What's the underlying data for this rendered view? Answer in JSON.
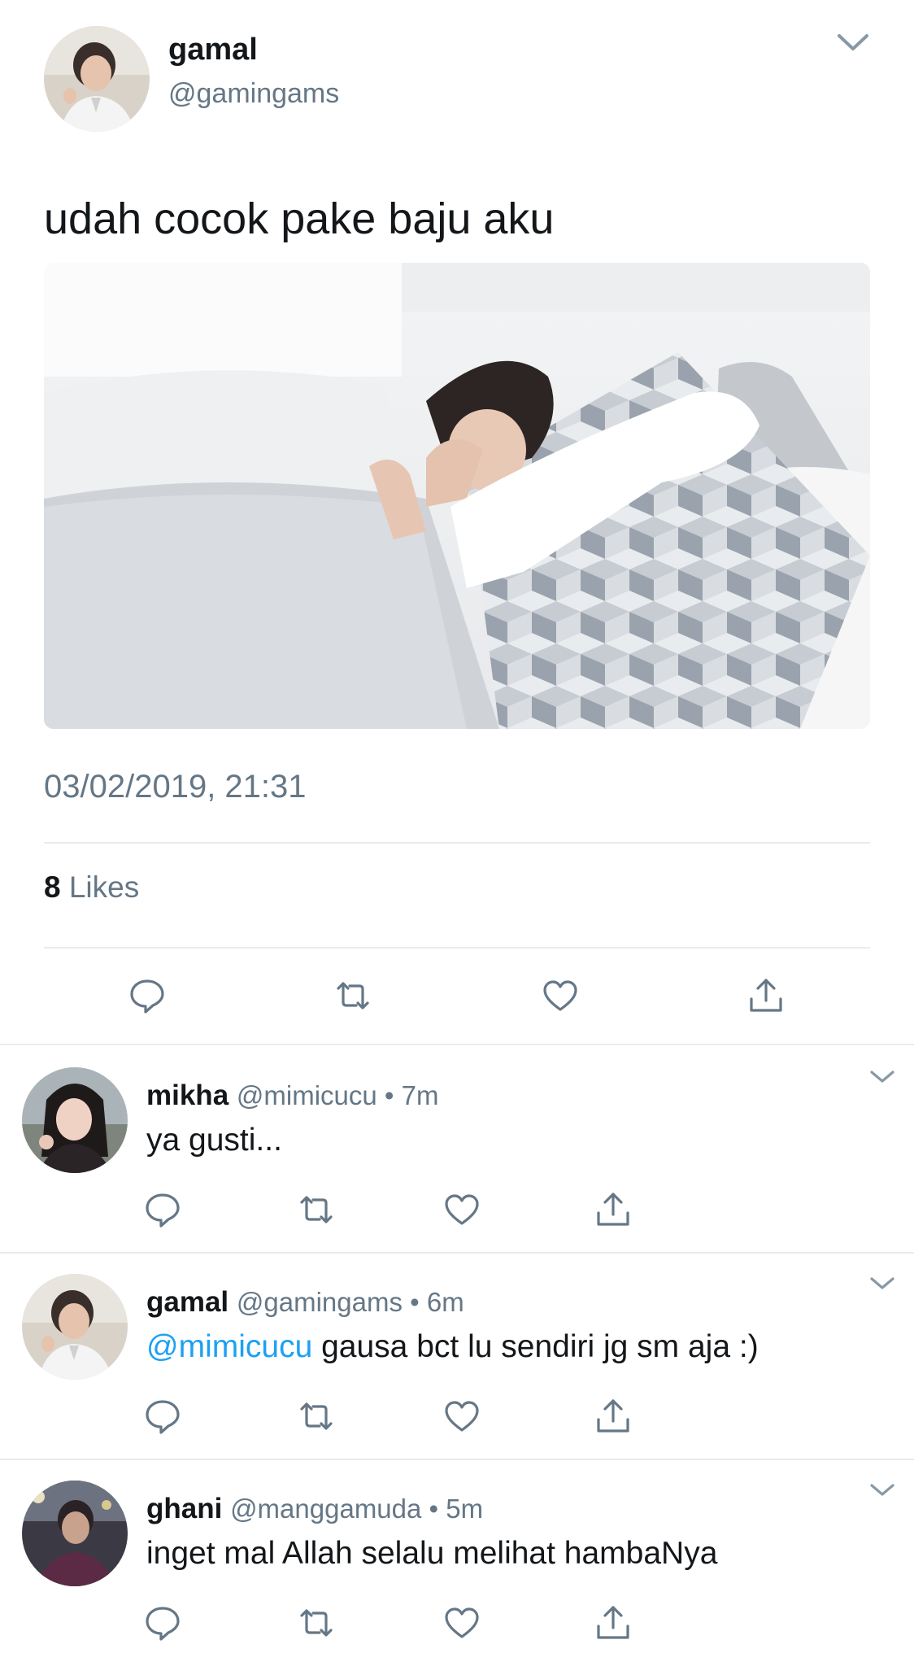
{
  "main_tweet": {
    "display_name": "gamal",
    "handle": "@gamingams",
    "text": "udah cocok pake baju aku",
    "timestamp": "03/02/2019, 21:31",
    "likes_count": "8",
    "likes_label": "Likes",
    "icons": [
      "reply-icon",
      "retweet-icon",
      "like-icon",
      "share-icon",
      "chevron-down-icon"
    ]
  },
  "replies": [
    {
      "display_name": "mikha",
      "handle": "@mimicucu",
      "separator": "•",
      "time": "7m",
      "mention": "",
      "text": "ya gusti..."
    },
    {
      "display_name": "gamal",
      "handle": "@gamingams",
      "separator": "•",
      "time": "6m",
      "mention": "@mimicucu",
      "text": "gausa bct lu sendiri jg sm aja :)"
    },
    {
      "display_name": "ghani",
      "handle": "@manggamuda",
      "separator": "•",
      "time": "5m",
      "mention": "",
      "text": "inget mal Allah selalu melihat hambaNya"
    }
  ],
  "colors": {
    "text_primary": "#14171a",
    "text_secondary": "#657786",
    "link": "#1da1f2",
    "divider": "#e6ecf0",
    "icon": "#657786"
  }
}
